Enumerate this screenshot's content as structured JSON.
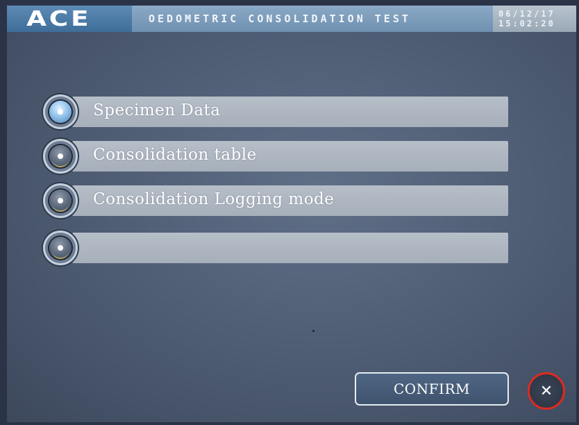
{
  "header": {
    "logo": "ACE",
    "title": "OEDOMETRIC CONSOLIDATION TEST",
    "date": "06/12/17",
    "time": "15:02:20"
  },
  "menu": {
    "items": [
      {
        "label": "Specimen Data",
        "selected": true
      },
      {
        "label": "Consolidation table",
        "selected": false
      },
      {
        "label": "Consolidation Logging mode",
        "selected": false
      },
      {
        "label": "",
        "selected": false
      }
    ]
  },
  "footer": {
    "confirm_label": "CONFIRM",
    "close_icon": "close-icon"
  },
  "colors": {
    "background": "#4d5b72",
    "header_logo": "#3e6d99",
    "close_ring": "#e02a20"
  }
}
